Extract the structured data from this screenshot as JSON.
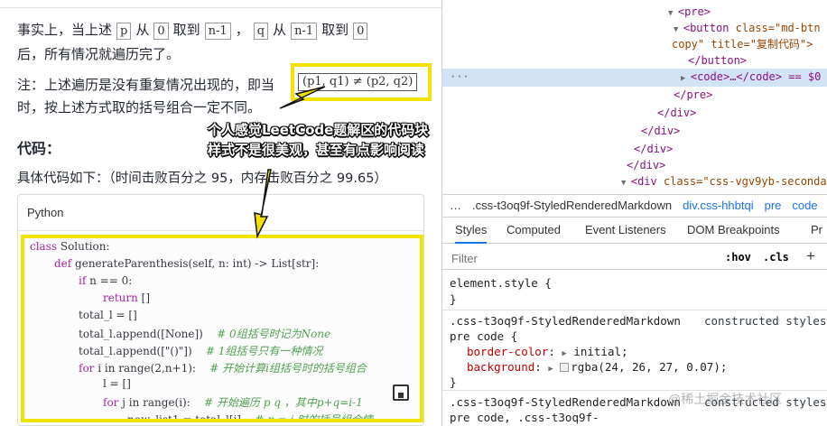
{
  "article": {
    "para1": {
      "t1": "事实上，当上述",
      "c1": "p",
      "t2": "从",
      "c2": "0",
      "t3": "取到",
      "c3": "n-1",
      "t4": "，",
      "c4": "q",
      "t5": "从",
      "c5": "n-1",
      "t6": "取到",
      "c6": "0",
      "line2": "后，所有情况就遍历完了。"
    },
    "para2": {
      "t1": "注：上述遍历是没有重复情况出现的，即当",
      "code": "(p1, q1) ≠ (p2, q2)",
      "line2": "时，按上述方式取的括号组合一定不同。"
    },
    "section_title": "代码：",
    "intro": "具体代码如下：（时间击败百分之 95，内存击败百分之 99.65）",
    "callout": {
      "line1": "个人感觉LeetCode题解区的代码块",
      "line2": "样式不是很美观，甚至有点影响阅读"
    },
    "code_lang": "Python",
    "code_lines": [
      {
        "indent": 0,
        "kw": "class",
        "rest": " Solution:",
        "comment": ""
      },
      {
        "indent": 1,
        "kw": "def",
        "rest": " generateParenthesis(self, n: int) -> List[str]:",
        "comment": ""
      },
      {
        "indent": 2,
        "kw": "if",
        "rest": " n == 0:",
        "comment": ""
      },
      {
        "indent": 3,
        "kw": "return",
        "rest": " []",
        "comment": ""
      },
      {
        "indent": 2,
        "kw": "",
        "rest": "total_l = []",
        "comment": ""
      },
      {
        "indent": 2,
        "kw": "",
        "rest": "total_l.append([None])",
        "comment": "    # 0组括号时记为None"
      },
      {
        "indent": 2,
        "kw": "",
        "rest": "total_l.append([\"()\"])",
        "comment": "    # 1组括号只有一种情况"
      },
      {
        "indent": 2,
        "kw": "for",
        "rest": " i in range(2,n+1):",
        "comment": "    # 开始计算i组括号时的括号组合"
      },
      {
        "indent": 3,
        "kw": "",
        "rest": "l = []",
        "comment": ""
      },
      {
        "indent": 3,
        "kw": "for",
        "rest": " j in range(i):",
        "comment": "    # 开始遍历 p q ，其中p+q=i-1"
      },
      {
        "indent": 4,
        "kw": "",
        "rest": "now_list1 = total_l[j]",
        "comment": "    # p = j 时的括号组合情"
      }
    ]
  },
  "devtools": {
    "dom_lines": [
      {
        "tag": "<pre>",
        "rest": ""
      },
      {
        "tag": "<button",
        "rest": " class=\"md-btn"
      },
      {
        "tag": "",
        "rest": "copy\" title=\"复制代码\">"
      },
      {
        "tag": "</button>",
        "rest": ""
      },
      {
        "tag": "<code>",
        "rest": "…</code> == $0"
      },
      {
        "tag": "</pre>",
        "rest": ""
      },
      {
        "tag": "</div>",
        "rest": ""
      },
      {
        "tag": "</div>",
        "rest": ""
      },
      {
        "tag": "</div>",
        "rest": ""
      },
      {
        "tag": "</div>",
        "rest": ""
      },
      {
        "tag": "<div",
        "rest": " class=\"css-vgv9yb-secondar"
      }
    ],
    "dots": "···",
    "breadcrumbs": [
      "…",
      ".css-t3oq9f-StyledRenderedMarkdown",
      "div.css-hhbtqi",
      "pre",
      "code"
    ],
    "tabs": [
      "Styles",
      "Computed",
      "Event Listeners",
      "DOM Breakpoints",
      "Pr"
    ],
    "filter_placeholder": "Filter",
    "hov": ":hov",
    "cls": ".cls",
    "plus": "+",
    "rules": {
      "element": {
        "selector": "element.style {",
        "close": "}"
      },
      "pre_code": {
        "selector": ".css-t3oq9f-StyledRenderedMarkdown",
        "selector2": "pre code {",
        "source": "constructed styles",
        "props": [
          {
            "name": "border-color",
            "value": "initial;"
          },
          {
            "name": "background",
            "value": "rgba(24, 26, 27, 0.07);"
          }
        ],
        "close": "}"
      },
      "third": {
        "selector": ".css-t3oq9f-StyledRenderedMarkdown",
        "selector2": "pre code, .css-t3oq9f-",
        "source": "constructed styles"
      }
    },
    "watermark": "@稀土掘金技术社区"
  },
  "colors": {
    "highlight": "#f2e200",
    "selected_row": "#d2e3f7",
    "accent": "#1a73e8"
  }
}
